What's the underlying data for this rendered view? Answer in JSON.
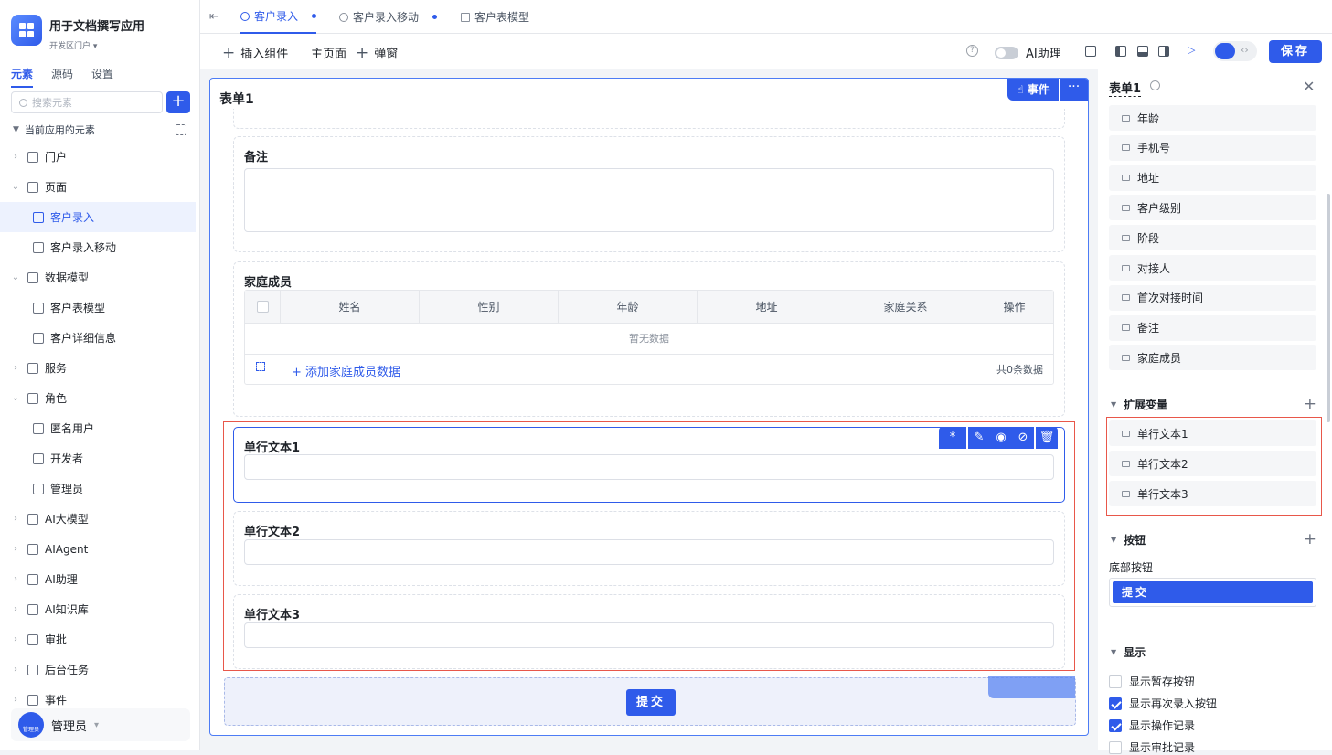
{
  "app": {
    "title": "用于文档撰写应用",
    "subtitle": "开发区门户"
  },
  "side_tabs": [
    "元素",
    "源码",
    "设置"
  ],
  "search": {
    "placeholder": "搜索元素"
  },
  "tree_header": "当前应用的元素",
  "tree": [
    {
      "label": "门户",
      "indent": 0,
      "chev": "›",
      "sel": false
    },
    {
      "label": "页面",
      "indent": 0,
      "chev": "⌄",
      "sel": false
    },
    {
      "label": "客户录入",
      "indent": 1,
      "chev": "",
      "sel": true
    },
    {
      "label": "客户录入移动",
      "indent": 1,
      "chev": "",
      "sel": false
    },
    {
      "label": "数据模型",
      "indent": 0,
      "chev": "⌄",
      "sel": false
    },
    {
      "label": "客户表模型",
      "indent": 1,
      "chev": "",
      "sel": false
    },
    {
      "label": "客户详细信息",
      "indent": 1,
      "chev": "",
      "sel": false
    },
    {
      "label": "服务",
      "indent": 0,
      "chev": "›",
      "sel": false
    },
    {
      "label": "角色",
      "indent": 0,
      "chev": "⌄",
      "sel": false
    },
    {
      "label": "匿名用户",
      "indent": 1,
      "chev": "",
      "sel": false
    },
    {
      "label": "开发者",
      "indent": 1,
      "chev": "",
      "sel": false
    },
    {
      "label": "管理员",
      "indent": 1,
      "chev": "",
      "sel": false
    },
    {
      "label": "AI大模型",
      "indent": 0,
      "chev": "›",
      "sel": false
    },
    {
      "label": "AIAgent",
      "indent": 0,
      "chev": "›",
      "sel": false
    },
    {
      "label": "AI助理",
      "indent": 0,
      "chev": "›",
      "sel": false
    },
    {
      "label": "AI知识库",
      "indent": 0,
      "chev": "›",
      "sel": false
    },
    {
      "label": "审批",
      "indent": 0,
      "chev": "›",
      "sel": false
    },
    {
      "label": "后台任务",
      "indent": 0,
      "chev": "›",
      "sel": false
    },
    {
      "label": "事件",
      "indent": 0,
      "chev": "›",
      "sel": false
    }
  ],
  "user": {
    "name": "管理员",
    "avatar_text": "管理员"
  },
  "tabs": [
    {
      "label": "客户录入",
      "active": true
    },
    {
      "label": "客户录入移动",
      "active": false
    },
    {
      "label": "客户表模型",
      "active": false
    }
  ],
  "toolbar": {
    "insert": "插入组件",
    "main_page": "主页面",
    "popup": "弹窗",
    "ai_label": "AI助理",
    "save": "保存"
  },
  "form": {
    "title": "表单1",
    "event_btn": "事件",
    "more_btn": "···",
    "remark_label": "备注",
    "family_label": "家庭成员",
    "columns": [
      "姓名",
      "性别",
      "年龄",
      "地址",
      "家庭关系",
      "操作"
    ],
    "empty_text": "暂无数据",
    "add_row": "添加家庭成员数据",
    "total": "共0条数据",
    "text1": "单行文本1",
    "text2": "单行文本2",
    "text3": "单行文本3",
    "submit": "提交"
  },
  "rpanel": {
    "title": "表单1",
    "fields": [
      "年龄",
      "手机号",
      "地址",
      "客户级别",
      "阶段",
      "对接人",
      "首次对接时间",
      "备注",
      "家庭成员"
    ],
    "ext_section": "扩展变量",
    "ext_vars": [
      "单行文本1",
      "单行文本2",
      "单行文本3"
    ],
    "btn_section": "按钮",
    "bottom_btn_label": "底部按钮",
    "bottom_btn": "提交",
    "display_section": "显示",
    "display_opts": [
      {
        "label": "显示暂存按钮",
        "checked": false
      },
      {
        "label": "显示再次录入按钮",
        "checked": true
      },
      {
        "label": "显示操作记录",
        "checked": true
      },
      {
        "label": "显示审批记录",
        "checked": false
      }
    ]
  },
  "colors": {
    "primary": "#2f5bea",
    "highlight": "#e8574a"
  }
}
